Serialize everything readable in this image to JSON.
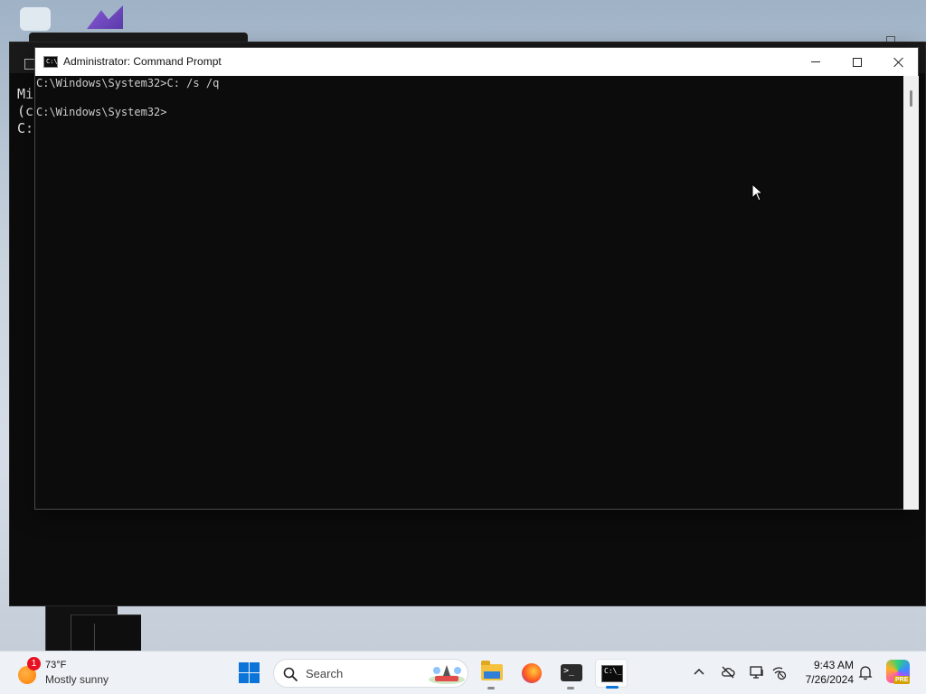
{
  "window": {
    "title": "Administrator: Command Prompt",
    "app_icon_text": "C:\\"
  },
  "console": {
    "lines": [
      "C:\\Windows\\System32>C: /s /q",
      "C:\\Windows\\System32>"
    ]
  },
  "background_console": {
    "lines": [
      "Mic",
      "(c",
      "",
      "C:\\"
    ]
  },
  "taskbar": {
    "weather": {
      "temperature": "73°F",
      "condition": "Mostly sunny",
      "badge": "1"
    },
    "search": {
      "label": "Search"
    },
    "clock": {
      "time": "9:43 AM",
      "date": "7/26/2024"
    },
    "terminal_icon_text": ">_",
    "cmd_icon_text": "C:\\_",
    "copilot_badge": "PRE"
  },
  "colors": {
    "console_bg": "#0c0c0c",
    "console_text": "#cccccc",
    "accent": "#0a74d8",
    "titlebar_bg": "#ffffff"
  },
  "icons": [
    "command-prompt-icon",
    "minimize-icon",
    "maximize-icon",
    "close-icon",
    "weather-sun-icon",
    "windows-start-icon",
    "search-icon",
    "file-explorer-icon",
    "firefox-icon",
    "terminal-icon",
    "chevron-up-icon",
    "cloud-off-icon",
    "display-icon",
    "status-icon",
    "notification-bell-icon",
    "copilot-icon"
  ]
}
